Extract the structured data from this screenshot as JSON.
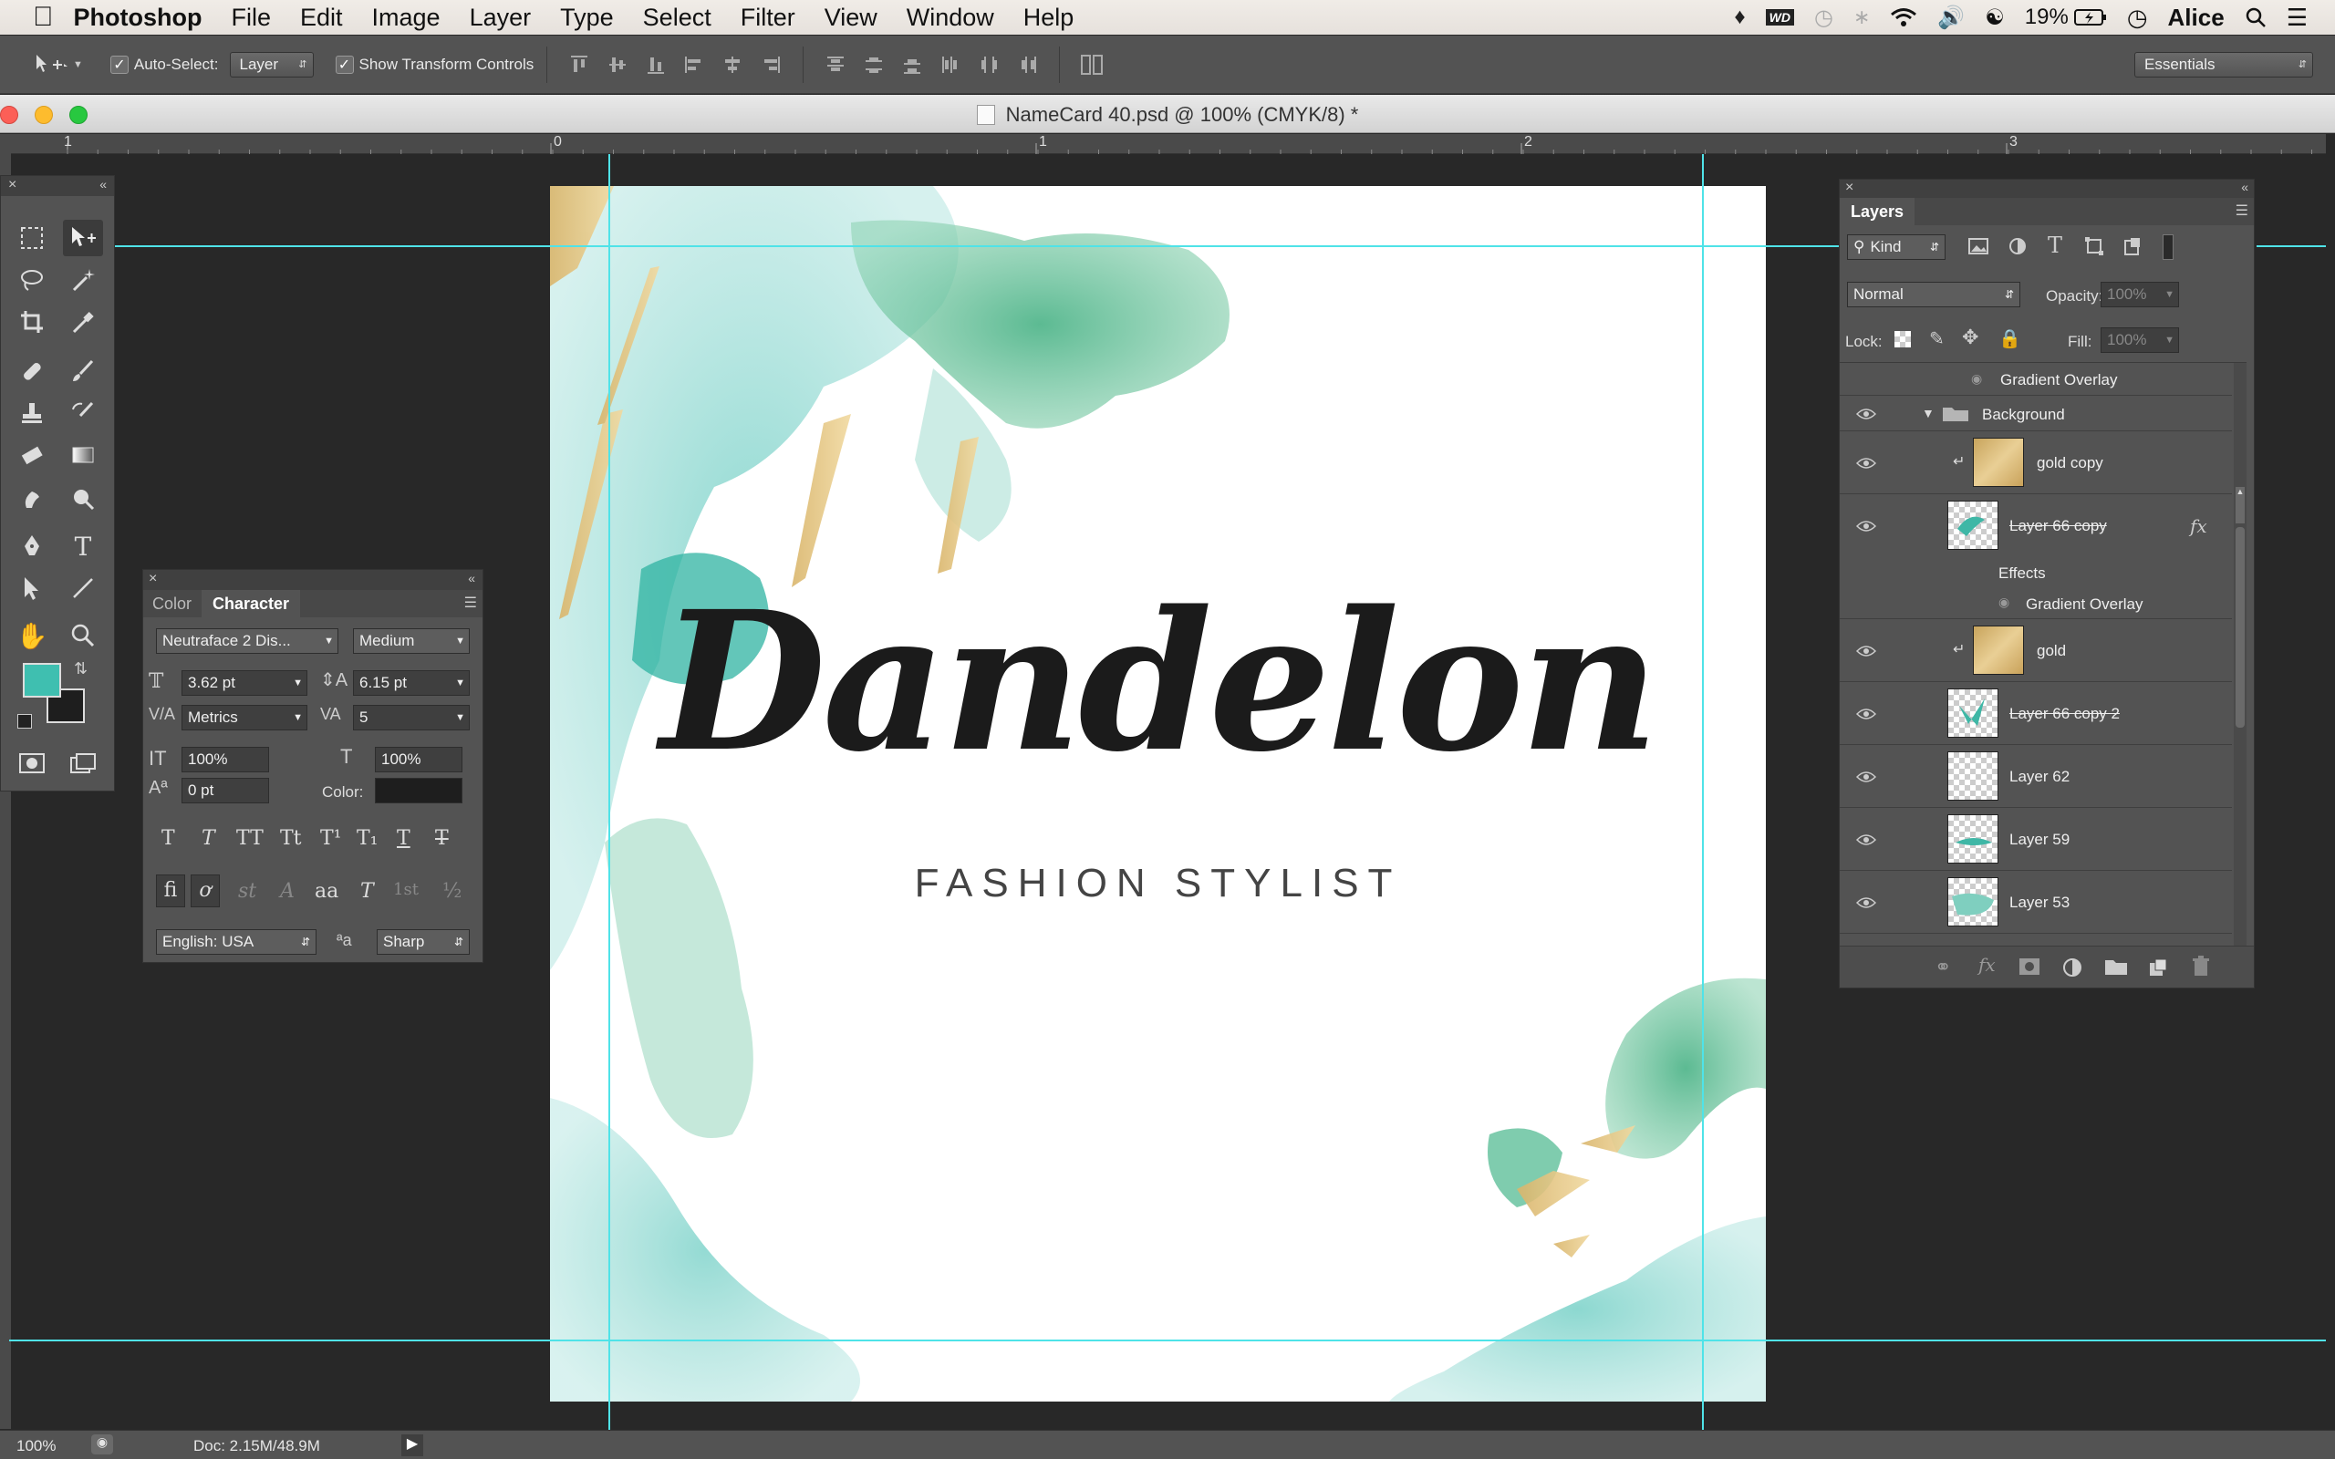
{
  "menubar": {
    "app_name": "Photoshop",
    "items": [
      "File",
      "Edit",
      "Image",
      "Layer",
      "Type",
      "Select",
      "Filter",
      "View",
      "Window",
      "Help"
    ],
    "battery": "19%",
    "user": "Alice"
  },
  "options": {
    "auto_select_label": "Auto-Select:",
    "auto_select_value": "Layer",
    "show_transform_label": "Show Transform Controls",
    "workspace": "Essentials"
  },
  "document": {
    "title": "NameCard 40.psd @ 100% (CMYK/8) *",
    "ruler_labels": [
      "1",
      "0",
      "1",
      "2",
      "3"
    ]
  },
  "canvas": {
    "headline": "Dandelon",
    "subtitle": "FASHION STYLIST"
  },
  "character_panel": {
    "tabs": [
      "Color",
      "Character"
    ],
    "font_family": "Neutraface 2 Dis...",
    "font_style": "Medium",
    "font_size": "3.62 pt",
    "leading": "6.15 pt",
    "kerning": "Metrics",
    "tracking": "5",
    "vertical_scale": "100%",
    "horizontal_scale": "100%",
    "baseline_shift": "0 pt",
    "color_label": "Color:",
    "language": "English: USA",
    "antialias_icon_label": "a",
    "antialias": "Sharp",
    "style_buttons": [
      "T",
      "T",
      "TT",
      "Tt",
      "T¹",
      "T₁",
      "T",
      "T"
    ],
    "opentype_buttons": [
      "fi",
      "ơ",
      "st",
      "A",
      "aa",
      "T",
      "1st",
      "½"
    ]
  },
  "layers_panel": {
    "title": "Layers",
    "filter_kind": "Kind",
    "blend_mode": "Normal",
    "opacity_label": "Opacity:",
    "opacity_value": "100%",
    "lock_label": "Lock:",
    "fill_label": "Fill:",
    "fill_value": "100%",
    "rows": [
      {
        "name": "Gradient Overlay"
      },
      {
        "name": "Background"
      },
      {
        "name": "gold copy"
      },
      {
        "name": "Layer 66 copy",
        "fx": "fx"
      },
      {
        "name": "Effects"
      },
      {
        "name": "Gradient Overlay"
      },
      {
        "name": "gold"
      },
      {
        "name": "Layer 66 copy 2"
      },
      {
        "name": "Layer 62"
      },
      {
        "name": "Layer 59"
      },
      {
        "name": "Layer 53"
      }
    ]
  },
  "status": {
    "zoom": "100%",
    "doc_size": "Doc: 2.15M/48.9M"
  },
  "colors": {
    "foreground": "#3fbfb0",
    "background": "#1e1e1e",
    "guide": "#4fe3e8",
    "chrome": "#535353"
  }
}
